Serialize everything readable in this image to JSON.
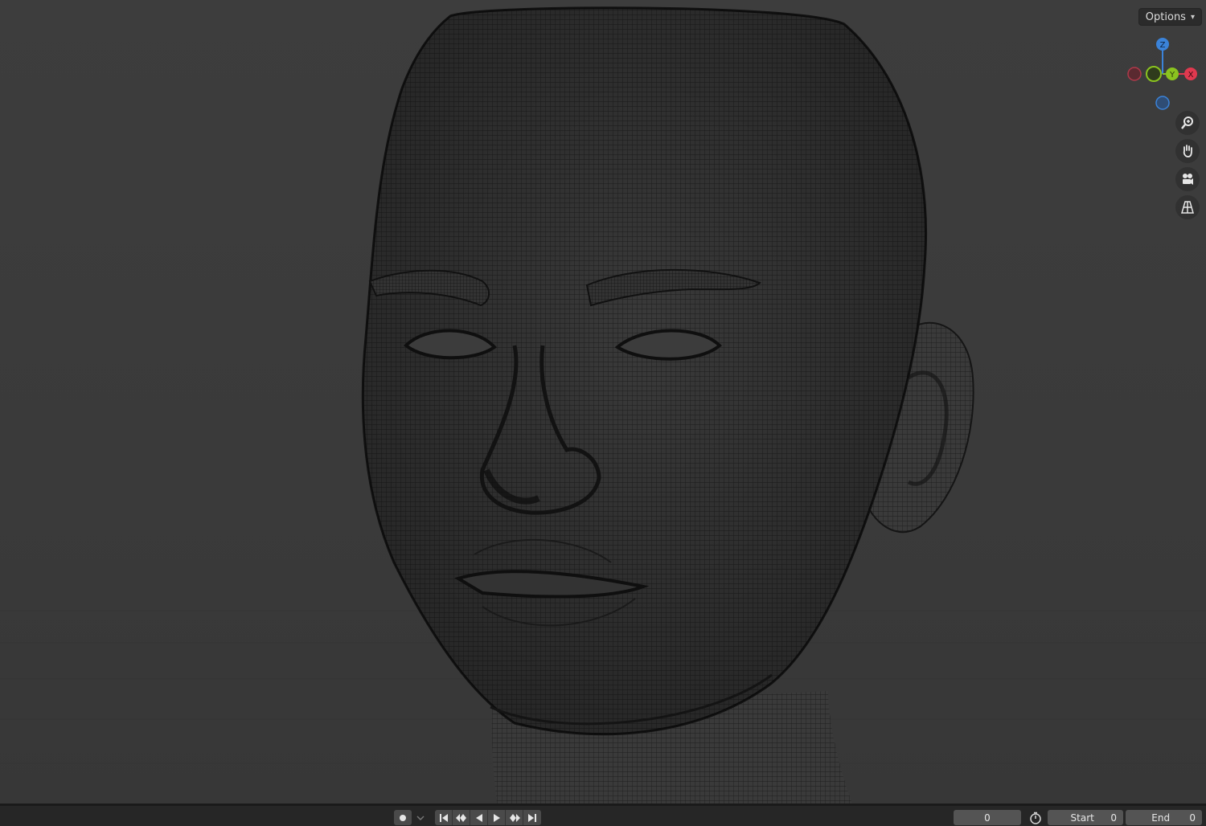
{
  "viewport": {
    "options_label": "Options",
    "options_chevron": "⌄",
    "gizmo": {
      "z_label": "Z",
      "y_label": "Y",
      "x_label": "X",
      "x_color": "#e0394f",
      "y_color": "#8ac31f",
      "z_color": "#3b83d9"
    },
    "nav_tools": [
      "zoom-icon",
      "hand-pan-icon",
      "camera-icon",
      "perspective-grid-icon"
    ]
  },
  "timeline": {
    "current_frame": "0",
    "start_label": "Start",
    "start_value": "0",
    "end_label": "End",
    "end_value": "0"
  }
}
